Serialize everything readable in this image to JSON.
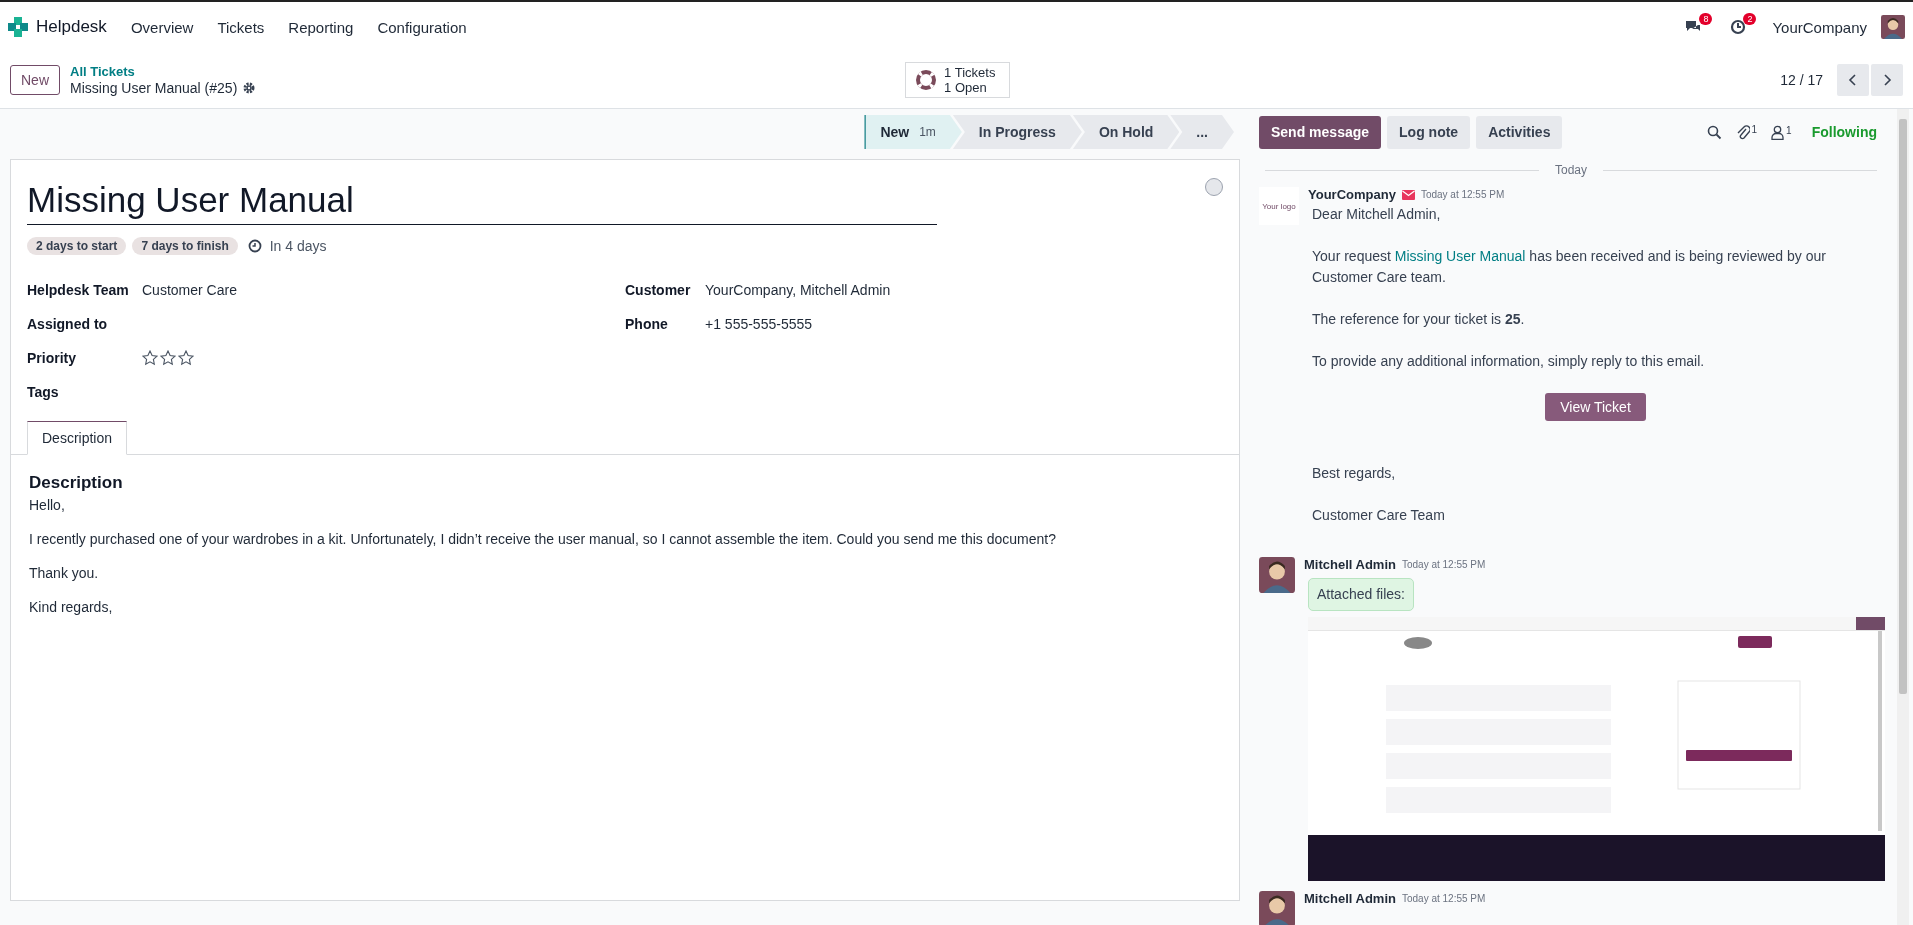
{
  "navbar": {
    "app": "Helpdesk",
    "menus": [
      "Overview",
      "Tickets",
      "Reporting",
      "Configuration"
    ],
    "messages_badge": "8",
    "activities_badge": "2",
    "company": "YourCompany"
  },
  "control_panel": {
    "new_button": "New",
    "breadcrumb": "All Tickets",
    "record": "Missing User Manual (#25)",
    "smart_button": {
      "line1": "1 Tickets",
      "line2": "1 Open"
    },
    "pager": "12 / 17"
  },
  "stages": [
    {
      "label": "New",
      "duration": "1m",
      "selected": true
    },
    {
      "label": "In Progress",
      "selected": false
    },
    {
      "label": "On Hold",
      "selected": false
    },
    {
      "label": "...",
      "selected": false
    }
  ],
  "ticket": {
    "title": "Missing User Manual",
    "tags": [
      "2 days to start",
      "7 days to finish"
    ],
    "deadline": "In 4 days",
    "fields_left": [
      {
        "label": "Helpdesk Team",
        "value": "Customer Care"
      },
      {
        "label": "Assigned to"
      },
      {
        "label": "Priority",
        "kind": "stars",
        "stars": 0
      },
      {
        "label": "Tags"
      }
    ],
    "fields_right": [
      {
        "label": "Customer",
        "value": "YourCompany, Mitchell Admin"
      },
      {
        "label": "Phone",
        "value": "+1 555-555-5555"
      }
    ],
    "tabs": [
      {
        "label": "Description",
        "selected": true
      }
    ],
    "description": {
      "heading": "Description",
      "paragraphs": [
        "Hello,",
        "I recently purchased one of your wardrobes in a kit. Unfortunately, I didn’t receive the user manual, so I cannot assemble the item. Could you send me this document?",
        "Thank you.",
        "Kind regards,"
      ]
    }
  },
  "chatter": {
    "buttons": [
      {
        "label": "Send message",
        "selected": true
      },
      {
        "label": "Log note",
        "selected": false
      },
      {
        "label": "Activities",
        "selected": false
      }
    ],
    "attachments_count": "1",
    "followers_count": "1",
    "follow_label": "Following",
    "date_separator": "Today",
    "messages": [
      {
        "author": "YourCompany",
        "kind": "company",
        "avatar_text": "Your logo",
        "via_email": true,
        "time": "Today at 12:55 PM",
        "body": [
          {
            "kind": "text",
            "text": "Dear Mitchell Admin,"
          },
          {
            "kind": "link_text",
            "before": "Your request ",
            "link": "Missing User Manual",
            "after": " has been received and is being reviewed by our Customer Care team."
          },
          {
            "kind": "text",
            "text": "The reference for your ticket is **25**."
          },
          {
            "kind": "text",
            "text": "To provide any additional information, simply reply to this email."
          },
          {
            "kind": "button",
            "text": "View Ticket"
          },
          {
            "kind": "text",
            "text": "Best regards,"
          },
          {
            "kind": "text",
            "text": "Customer Care Team"
          }
        ]
      },
      {
        "author": "Mitchell Admin",
        "kind": "user",
        "via_email": false,
        "time": "Today at 12:55 PM",
        "body": [
          {
            "kind": "bubble",
            "text": "Attached files:"
          },
          {
            "kind": "picture"
          }
        ]
      },
      {
        "author": "Mitchell Admin",
        "kind": "user",
        "via_email": false,
        "time": "Today at 12:55 PM"
      }
    ]
  }
}
